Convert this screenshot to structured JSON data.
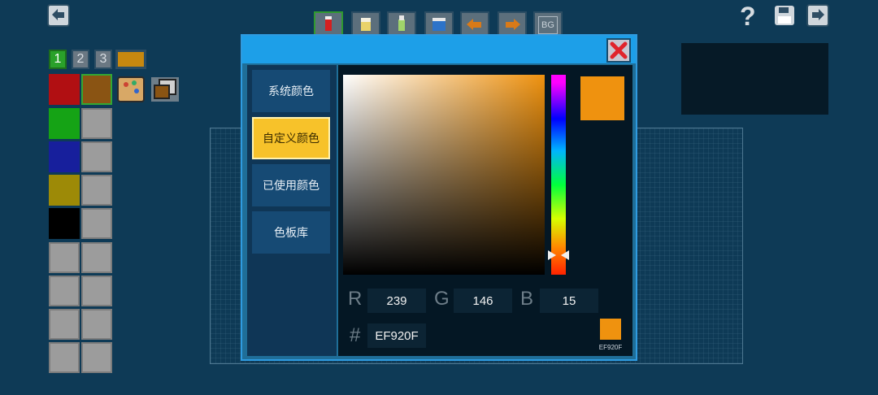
{
  "colors": {
    "selected": "#EF920F",
    "background": "#0e3a56",
    "dialog_title": "#1d9fe8",
    "active_menu": "#f7c22a"
  },
  "topbar": {
    "left_icon": "undo-arrow-icon",
    "right_icons": [
      "help-icon",
      "save-disk-icon",
      "redo-arrow-icon"
    ],
    "help_label": "?"
  },
  "toolbar": {
    "tools": [
      {
        "icon": "pencil-tool-icon"
      },
      {
        "icon": "eraser-tool-icon"
      },
      {
        "icon": "bucket-tool-icon"
      },
      {
        "icon": "fill-tool-icon"
      },
      {
        "icon": "undo-tool-icon"
      },
      {
        "icon": "redo-tool-icon"
      },
      {
        "icon": "bg-tool-icon",
        "label": "BG"
      }
    ]
  },
  "layers": {
    "numbers": [
      "1",
      "2",
      "3"
    ],
    "active": "1"
  },
  "palette": {
    "swatches": [
      "#b10f12",
      "#8a5413",
      "#15a315",
      "#171f9c",
      "#9d8a07",
      "#000000"
    ]
  },
  "dialog": {
    "close_icon": "close-x-icon",
    "menu": [
      {
        "label": "系统颜色",
        "active": false
      },
      {
        "label": "自定义颜色",
        "active": true
      },
      {
        "label": "已使用颜色",
        "active": false
      },
      {
        "label": "色板库",
        "active": false
      }
    ],
    "channels": [
      {
        "letter": "R",
        "value": "239"
      },
      {
        "letter": "G",
        "value": "146"
      },
      {
        "letter": "B",
        "value": "15"
      }
    ],
    "hash": "#",
    "hex_value": "EF920F",
    "preview_hex": "EF920F"
  }
}
